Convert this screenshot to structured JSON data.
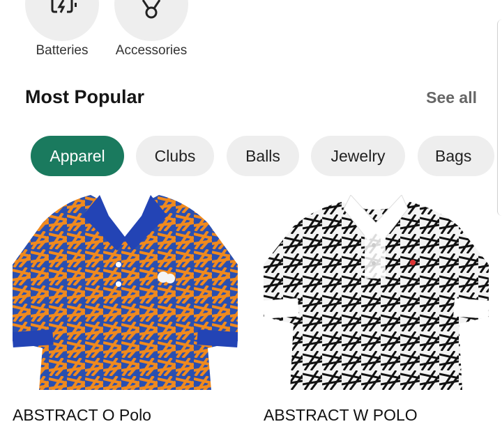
{
  "categories": [
    {
      "label": "Batteries",
      "icon": "battery-charging-icon"
    },
    {
      "label": "Accessories",
      "icon": "medal-icon"
    }
  ],
  "section": {
    "title": "Most Popular",
    "see_all": "See all"
  },
  "chips": [
    {
      "label": "Apparel",
      "active": true
    },
    {
      "label": "Clubs",
      "active": false
    },
    {
      "label": "Balls",
      "active": false
    },
    {
      "label": "Jewelry",
      "active": false
    },
    {
      "label": "Bags",
      "active": false
    }
  ],
  "products": [
    {
      "name": "ABSTRACT O Polo",
      "image": "orange-blue-abstract-polo-shirt"
    },
    {
      "name": "ABSTRACT W POLO",
      "image": "black-white-abstract-polo-shirt"
    }
  ],
  "colors": {
    "accent": "#1a7a5e",
    "chip_bg": "#eeeeee",
    "circle_bg": "#eeeeee"
  }
}
